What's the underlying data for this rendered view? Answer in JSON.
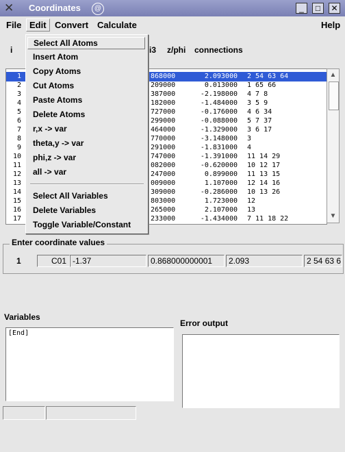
{
  "window": {
    "title": "Coordinates",
    "app_icon": "x-icon",
    "buttons": [
      "minimize-icon",
      "maximize-icon",
      "close-icon"
    ]
  },
  "menubar": {
    "file": "File",
    "edit": "Edit",
    "convert": "Convert",
    "calculate": "Calculate",
    "help": "Help"
  },
  "headers": {
    "i": "i",
    "i3": "i3",
    "zphi": "z/phi",
    "connections": "connections"
  },
  "rows": [
    {
      "n": "1",
      "c2": ".868000",
      "c3": "2.093000",
      "conn": "2 54 63 64"
    },
    {
      "n": "2",
      "c2": ".209000",
      "c3": "0.013000",
      "conn": "1 65 66"
    },
    {
      "n": "3",
      "c2": ".387000",
      "c3": "-2.198000",
      "conn": "4 7 8"
    },
    {
      "n": "4",
      "c2": ".182000",
      "c3": "-1.484000",
      "conn": "3 5 9"
    },
    {
      "n": "5",
      "c2": ".727000",
      "c3": "-0.176000",
      "conn": "4 6 34"
    },
    {
      "n": "6",
      "c2": ".299000",
      "c3": "-0.088000",
      "conn": "5 7 37"
    },
    {
      "n": "7",
      "c2": ".464000",
      "c3": "-1.329000",
      "conn": "3 6 17"
    },
    {
      "n": "8",
      "c2": ".770000",
      "c3": "-3.148000",
      "conn": "3"
    },
    {
      "n": "9",
      "c2": ".291000",
      "c3": "-1.831000",
      "conn": "4"
    },
    {
      "n": "10",
      "c2": ".747000",
      "c3": "-1.391000",
      "conn": "11 14 29"
    },
    {
      "n": "11",
      "c2": ".082000",
      "c3": "-0.620000",
      "conn": "10 12 17"
    },
    {
      "n": "12",
      "c2": ".247000",
      "c3": "0.899000",
      "conn": "11 13 15"
    },
    {
      "n": "13",
      "c2": ".009000",
      "c3": "1.107000",
      "conn": "12 14 16"
    },
    {
      "n": "14",
      "c2": ".309000",
      "c3": "-0.286000",
      "conn": "10 13 26"
    },
    {
      "n": "15",
      "c2": ".803000",
      "c3": "1.723000",
      "conn": "12"
    },
    {
      "n": "16",
      "c2": ".265000",
      "c3": "2.107000",
      "conn": "13"
    },
    {
      "n": "17",
      "c2": ".233000",
      "c3": "-1.434000",
      "conn": "7 11 18 22"
    }
  ],
  "edit_menu": {
    "items": [
      "Select All Atoms",
      "Insert Atom",
      "Copy Atoms",
      "Cut Atoms",
      "Paste Atoms",
      "Delete Atoms",
      "r,x -> var",
      "theta,y -> var",
      "phi,z -> var",
      "all -> var"
    ],
    "items2": [
      "Select All Variables",
      "Delete Variables",
      "Toggle Variable/Constant"
    ]
  },
  "coord": {
    "title": "Enter coordinate values",
    "index": "1",
    "name": "C01",
    "v1": "-1.37",
    "v2": "0.868000000001",
    "v3": "2.093",
    "v4": "2 54 63 6"
  },
  "variables": {
    "label": "Variables",
    "content": "[End]"
  },
  "error": {
    "label": "Error output"
  },
  "colors": {
    "title_bar": "#8a90c0",
    "selection": "#2f5bd6",
    "background": "#e6e6e6"
  }
}
